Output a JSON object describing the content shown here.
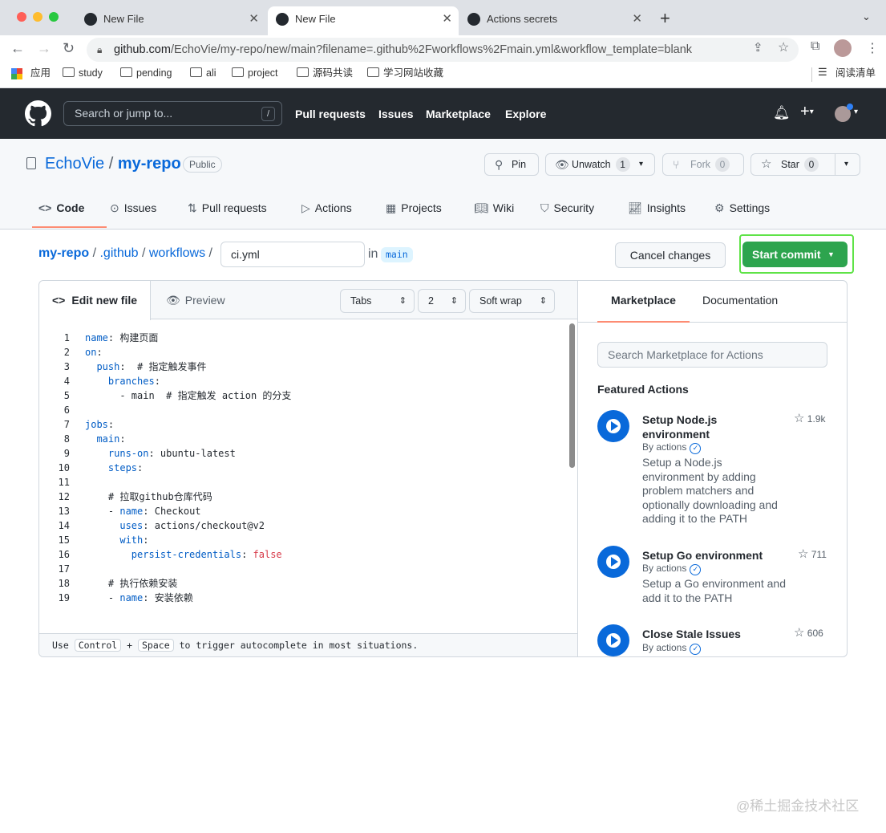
{
  "browser": {
    "tabs": [
      {
        "title": "New File",
        "active": false
      },
      {
        "title": "New File",
        "active": true
      },
      {
        "title": "Actions secrets",
        "active": false
      }
    ],
    "url_host": "github.com",
    "url_path": "/EchoVie/my-repo/new/main?filename=.github%2Fworkflows%2Fmain.yml&workflow_template=blank",
    "bookmarks": [
      "应用",
      "study",
      "pending",
      "ali",
      "project",
      "源码共读",
      "学习网站收藏"
    ],
    "reading_list": "阅读清单"
  },
  "gh": {
    "search_placeholder": "Search or jump to...",
    "slash": "/",
    "nav": [
      "Pull requests",
      "Issues",
      "Marketplace",
      "Explore"
    ]
  },
  "repo": {
    "owner": "EchoVie",
    "sep": "/",
    "name": "my-repo",
    "visibility": "Public",
    "pin": "Pin",
    "unwatch": "Unwatch",
    "unwatch_count": "1",
    "fork": "Fork",
    "fork_count": "0",
    "star": "Star",
    "star_count": "0",
    "tabs": [
      "Code",
      "Issues",
      "Pull requests",
      "Actions",
      "Projects",
      "Wiki",
      "Security",
      "Insights",
      "Settings"
    ]
  },
  "editor": {
    "crumbs": [
      "my-repo",
      ".github",
      "workflows"
    ],
    "filename": "ci.yml",
    "in": "in",
    "branch": "main",
    "cancel": "Cancel changes",
    "commit": "Start commit",
    "tab_edit": "Edit new file",
    "tab_preview": "Preview",
    "indent_mode": "Tabs",
    "indent_size": "2",
    "wrap": "Soft wrap",
    "footer_pre": "Use",
    "footer_key1": "Control",
    "footer_plus": "+",
    "footer_key2": "Space",
    "footer_post": "to trigger autocomplete in most situations."
  },
  "code_lines": [
    "name: 构建页面",
    "on:",
    "  push:  # 指定触发事件",
    "    branches:",
    "      - main  # 指定触发 action 的分支",
    "",
    "jobs:",
    "  main:",
    "    runs-on: ubuntu-latest",
    "    steps:",
    "",
    "    # 拉取github仓库代码",
    "    - name: Checkout",
    "      uses: actions/checkout@v2",
    "      with:",
    "        persist-credentials: false",
    "",
    "    # 执行依赖安装",
    "    - name: 安装依赖"
  ],
  "sidebar": {
    "tab_market": "Marketplace",
    "tab_docs": "Documentation",
    "search_placeholder": "Search Marketplace for Actions",
    "featured": "Featured Actions",
    "actions": [
      {
        "title": "Setup Node.js environment",
        "by": "By actions",
        "desc": "Setup a Node.js environment by adding problem matchers and optionally downloading and adding it to the PATH",
        "stars": "1.9k"
      },
      {
        "title": "Setup Go environment",
        "by": "By actions",
        "desc": "Setup a Go environment and add it to the PATH",
        "stars": "711"
      },
      {
        "title": "Close Stale Issues",
        "by": "By actions",
        "desc": "",
        "stars": "606"
      }
    ]
  },
  "watermark": "@稀土掘金技术社区",
  "colors": {
    "accent": "#0969da",
    "commit": "#2da44e",
    "highlight": "#5fe347"
  }
}
